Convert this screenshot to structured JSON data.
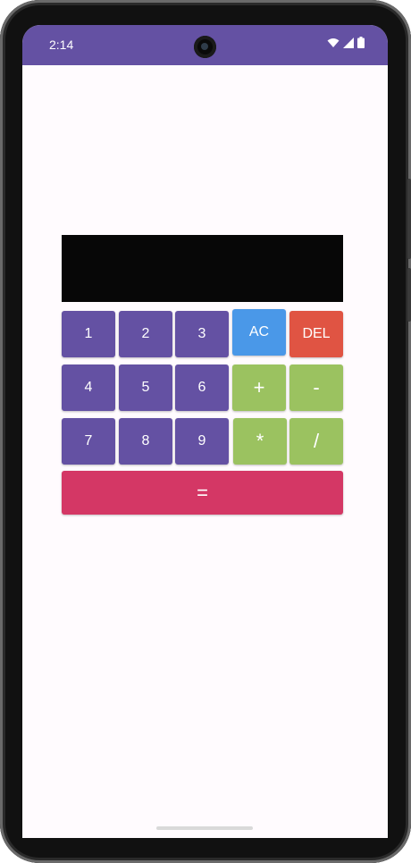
{
  "status_bar": {
    "time": "2:14",
    "icons": [
      "wifi-icon",
      "cellular-signal-icon",
      "battery-icon"
    ],
    "color": "#6451a3"
  },
  "calculator": {
    "display_value": "",
    "rows": [
      [
        "1",
        "2",
        "3",
        "AC",
        "DEL"
      ],
      [
        "4",
        "5",
        "6",
        "+",
        "-"
      ],
      [
        "7",
        "8",
        "9",
        "*",
        "/"
      ]
    ],
    "equals": "=",
    "colors": {
      "number": "#6451a3",
      "clear": "#4a98e8",
      "delete": "#e05443",
      "operator": "#9bc260",
      "equals": "#d43765",
      "display": "#070707"
    }
  }
}
